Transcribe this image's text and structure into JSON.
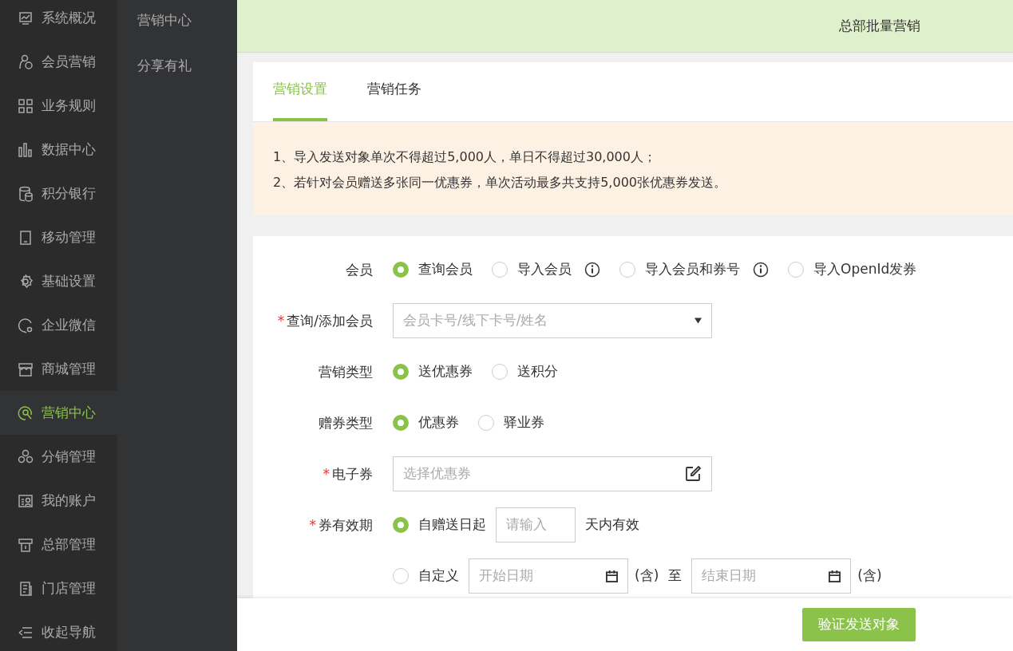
{
  "sidebar": {
    "items": [
      {
        "label": "系统概况",
        "selected": false
      },
      {
        "label": "会员营销",
        "selected": false
      },
      {
        "label": "业务规则",
        "selected": false
      },
      {
        "label": "数据中心",
        "selected": false
      },
      {
        "label": "积分银行",
        "selected": false
      },
      {
        "label": "移动管理",
        "selected": false
      },
      {
        "label": "基础设置",
        "selected": false
      },
      {
        "label": "企业微信",
        "selected": false
      },
      {
        "label": "商城管理",
        "selected": false
      },
      {
        "label": "营销中心",
        "selected": true
      },
      {
        "label": "分销管理",
        "selected": false
      },
      {
        "label": "我的账户",
        "selected": false
      },
      {
        "label": "总部管理",
        "selected": false
      },
      {
        "label": "门店管理",
        "selected": false
      },
      {
        "label": "收起导航",
        "selected": false
      }
    ]
  },
  "submenu": {
    "items": [
      {
        "label": "营销中心"
      },
      {
        "label": "分享有礼"
      }
    ]
  },
  "header": {
    "title": "总部批量营销"
  },
  "tabs": [
    {
      "label": "营销设置",
      "selected": true
    },
    {
      "label": "营销任务",
      "selected": false
    }
  ],
  "notice": {
    "lines": [
      "1、导入发送对象单次不得超过5,000人，单日不得超过30,000人；",
      "2、若针对会员赠送多张同一优惠券，单次活动最多共支持5,000张优惠券发送。"
    ]
  },
  "form": {
    "rows": [
      {
        "label": "会员",
        "kind": "radio",
        "options": [
          {
            "label": "查询会员",
            "selected": true
          },
          {
            "label": "导入会员",
            "selected": false,
            "info": true
          },
          {
            "label": "导入会员和券号",
            "selected": false,
            "info": true
          },
          {
            "label": "导入OpenId发券",
            "selected": false
          }
        ]
      },
      {
        "mark": "*",
        "label": "查询/添加会员",
        "kind": "select",
        "placeholder": "会员卡号/线下卡号/姓名"
      },
      {
        "label": "营销类型",
        "kind": "radio",
        "options": [
          {
            "label": "送优惠券",
            "selected": true
          },
          {
            "label": "送积分",
            "selected": false
          }
        ]
      },
      {
        "label": "赠券类型",
        "kind": "radio",
        "options": [
          {
            "label": "优惠券",
            "selected": true
          },
          {
            "label": "驿业券",
            "selected": false
          }
        ]
      },
      {
        "mark": "*",
        "label": "电子券",
        "kind": "picker",
        "placeholder": "选择优惠券"
      },
      {
        "mark": "*",
        "label": "券有效期",
        "kind": "radio_lines",
        "options": [
          {
            "label": "自赠送日起",
            "selected": true,
            "parts": [
              {
                "kind": "input",
                "placeholder": "请输入"
              },
              {
                "kind": "text",
                "text": "天内有效"
              }
            ]
          },
          {
            "label": "自定义",
            "selected": false,
            "parts": [
              {
                "kind": "date",
                "placeholder": "开始日期"
              },
              {
                "kind": "text",
                "text": "(含)"
              },
              {
                "kind": "text",
                "text": "至"
              },
              {
                "kind": "date",
                "placeholder": "结束日期"
              },
              {
                "kind": "text",
                "text": "(含)"
              }
            ]
          }
        ]
      }
    ]
  },
  "footer": {
    "button": "验证发送对象"
  }
}
